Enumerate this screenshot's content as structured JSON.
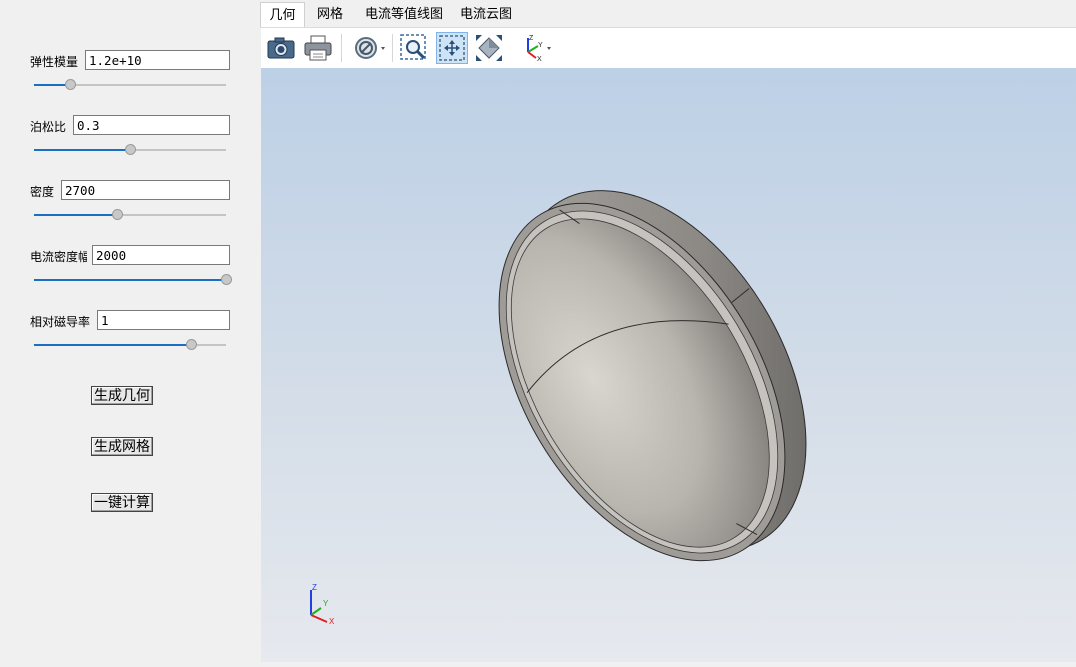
{
  "params": [
    {
      "label": "弹性模量",
      "value": "1.2e+10",
      "slider": 0.19
    },
    {
      "label": "泊松比",
      "value": "0.3",
      "slider": 0.5
    },
    {
      "label": "密度",
      "value": "2700",
      "slider": 0.43
    },
    {
      "label": "电流密度幅",
      "value": "2000",
      "slider": 1.0
    },
    {
      "label": "相对磁导率",
      "value": "1",
      "slider": 0.82
    }
  ],
  "buttons": {
    "generate_geometry": "生成几何",
    "generate_mesh": "生成网格",
    "compute": "一键计算"
  },
  "tabs": [
    "几何",
    "网格",
    "电流等值线图",
    "电流云图"
  ],
  "active_tab": "几何",
  "axes": {
    "x": "X",
    "y": "Y",
    "z": "Z"
  },
  "colors": {
    "slider_fill": "#1a6fc4",
    "axis_x": "#e02020",
    "axis_y": "#20b020",
    "axis_z": "#2040e0"
  }
}
